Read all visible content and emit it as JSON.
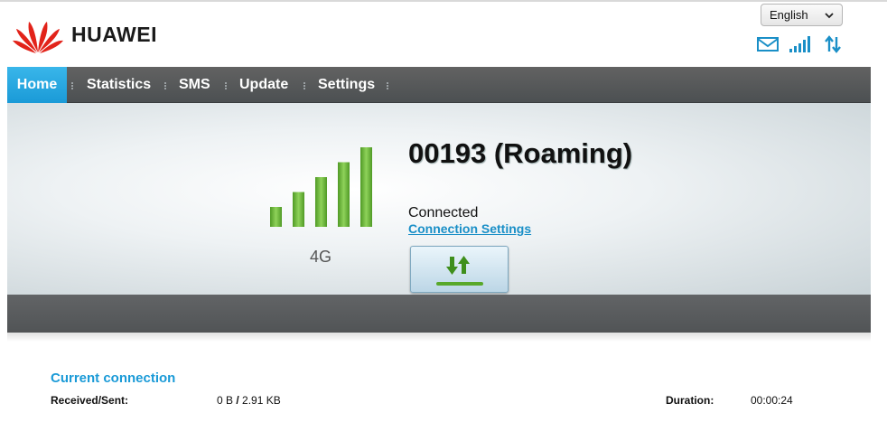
{
  "header": {
    "brand": "HUAWEI",
    "language": "English",
    "status_icons": [
      "mail-icon",
      "signal-strength-icon",
      "data-transfer-icon"
    ]
  },
  "nav": {
    "items": [
      {
        "label": "Home",
        "active": true
      },
      {
        "label": "Statistics",
        "active": false
      },
      {
        "label": "SMS",
        "active": false
      },
      {
        "label": "Update",
        "active": false
      },
      {
        "label": "Settings",
        "active": false
      }
    ]
  },
  "panel": {
    "signal_bars": 5,
    "signal_bars_filled": 5,
    "network_type": "4G",
    "provider": "00193 (Roaming)",
    "status": "Connected",
    "settings_link": "Connection Settings",
    "connect_button_icon": "data-transfer-icon"
  },
  "current_connection": {
    "title": "Current connection",
    "received_sent_label": "Received/Sent:",
    "received": "0 B",
    "separator": "/",
    "sent": "2.91 KB",
    "duration_label": "Duration:",
    "duration": "00:00:24"
  },
  "colors": {
    "accent": "#1a9ad7",
    "nav_bg": "#55595b",
    "signal_green": "#6ab23a"
  }
}
